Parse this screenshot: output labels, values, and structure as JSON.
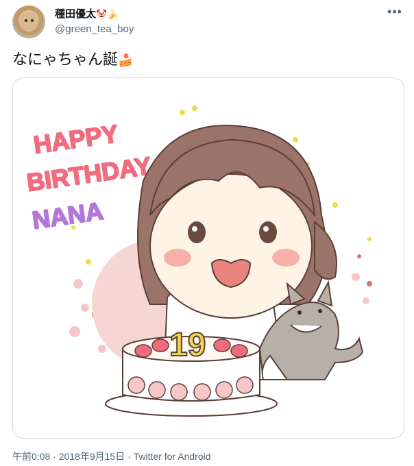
{
  "author": {
    "display_name": "種田優太",
    "name_emoji": "🤡🍌",
    "handle": "@green_tea_boy"
  },
  "more_menu": "•••",
  "tweet": {
    "text": "なにゃちゃん誕",
    "emoji": "🍰"
  },
  "media": {
    "art_text_line1": "HAPPY",
    "art_text_line2": "BIRTHDAY",
    "art_text_line3": "NANA",
    "cake_number": "19"
  },
  "meta": {
    "time": "午前0:08",
    "date": "2018年9月15日",
    "source": "Twitter for Android",
    "separator": "·"
  },
  "colors": {
    "pink_text": "#f06c7e",
    "purple_text": "#b277d8",
    "secondary_text": "#536471",
    "border": "#cfd9de"
  }
}
